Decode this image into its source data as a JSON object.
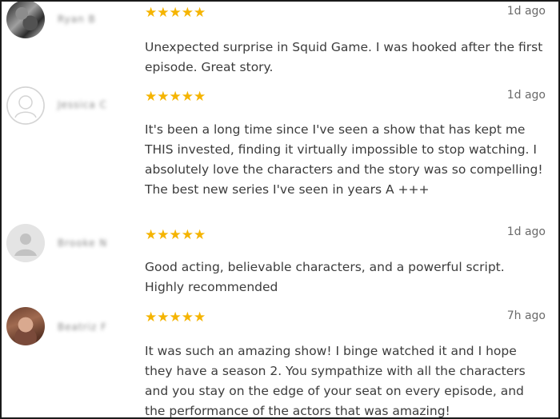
{
  "reviews": [
    {
      "reviewer": "Ryan B",
      "avatar": "photo",
      "stars": "★★★★★",
      "rating": 5,
      "time": "1d ago",
      "text": "Unexpected surprise in Squid Game. I was hooked after the first episode. Great story."
    },
    {
      "reviewer": "Jessica C",
      "avatar": "placeholder",
      "stars": "★★★★★",
      "rating": 5,
      "time": "1d ago",
      "text": "It's been a long time since I've seen a show that has kept me THIS invested, finding it virtually impossible to stop watching. I absolutely love the characters and the story was so compelling! The best new series I've seen in years A +++"
    },
    {
      "reviewer": "Brooke N",
      "avatar": "placeholder",
      "stars": "★★★★★",
      "rating": 5,
      "time": "1d ago",
      "text": "Good acting, believable characters, and a powerful script. Highly recommended"
    },
    {
      "reviewer": "Beatriz F",
      "avatar": "photo",
      "stars": "★★★★★",
      "rating": 5,
      "time": "7h ago",
      "text": "It was such an amazing show! I binge watched it and I hope they have a season 2. You sympathize with all the characters and you stay on the edge of your seat on every episode, and the performance of the actors that was amazing!"
    }
  ],
  "colors": {
    "star": "#f5b400",
    "text": "#3c3c3c",
    "meta": "#6a6a6a",
    "border": "#1a1a1a"
  }
}
